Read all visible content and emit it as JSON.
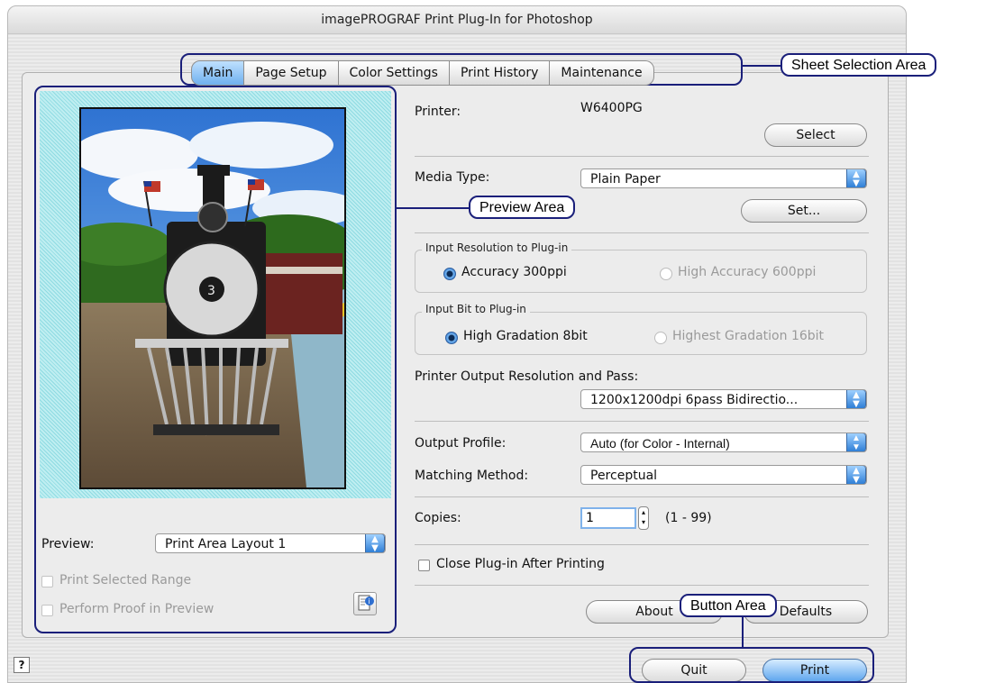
{
  "window": {
    "title": "imagePROGRAF Print Plug-In for Photoshop"
  },
  "tabs": [
    "Main",
    "Page Setup",
    "Color Settings",
    "Print History",
    "Maintenance"
  ],
  "printer": {
    "label": "Printer:",
    "value": "W6400PG",
    "select_button": "Select"
  },
  "media": {
    "label": "Media Type:",
    "value": "Plain Paper",
    "set_button": "Set..."
  },
  "input_resolution": {
    "group_label": "Input Resolution to Plug-in",
    "option_a": "Accuracy 300ppi",
    "option_b": "High Accuracy 600ppi",
    "selected": "Accuracy 300ppi"
  },
  "input_bit": {
    "group_label": "Input Bit to Plug-in",
    "option_a": "High Gradation 8bit",
    "option_b": "Highest Gradation 16bit",
    "selected": "High Gradation 8bit"
  },
  "output_resolution": {
    "label": "Printer Output Resolution and Pass:",
    "value": "1200x1200dpi 6pass Bidirectio..."
  },
  "output_profile": {
    "label": "Output Profile:",
    "value": "Auto (for Color - Internal)"
  },
  "matching_method": {
    "label": "Matching Method:",
    "value": "Perceptual"
  },
  "copies": {
    "label": "Copies:",
    "value": "1",
    "range": "(1 - 99)"
  },
  "close_after": {
    "label": "Close Plug-in After Printing",
    "checked": false
  },
  "buttons": {
    "about": "About",
    "defaults": "Defaults",
    "quit": "Quit",
    "print": "Print"
  },
  "preview": {
    "label": "Preview:",
    "value": "Print Area Layout 1",
    "print_selected_range": "Print Selected Range",
    "perform_proof": "Perform Proof in Preview"
  },
  "callouts": {
    "sheet_selection": "Sheet Selection Area",
    "preview_area": "Preview Area",
    "button_area": "Button Area"
  },
  "help_icon": "?"
}
